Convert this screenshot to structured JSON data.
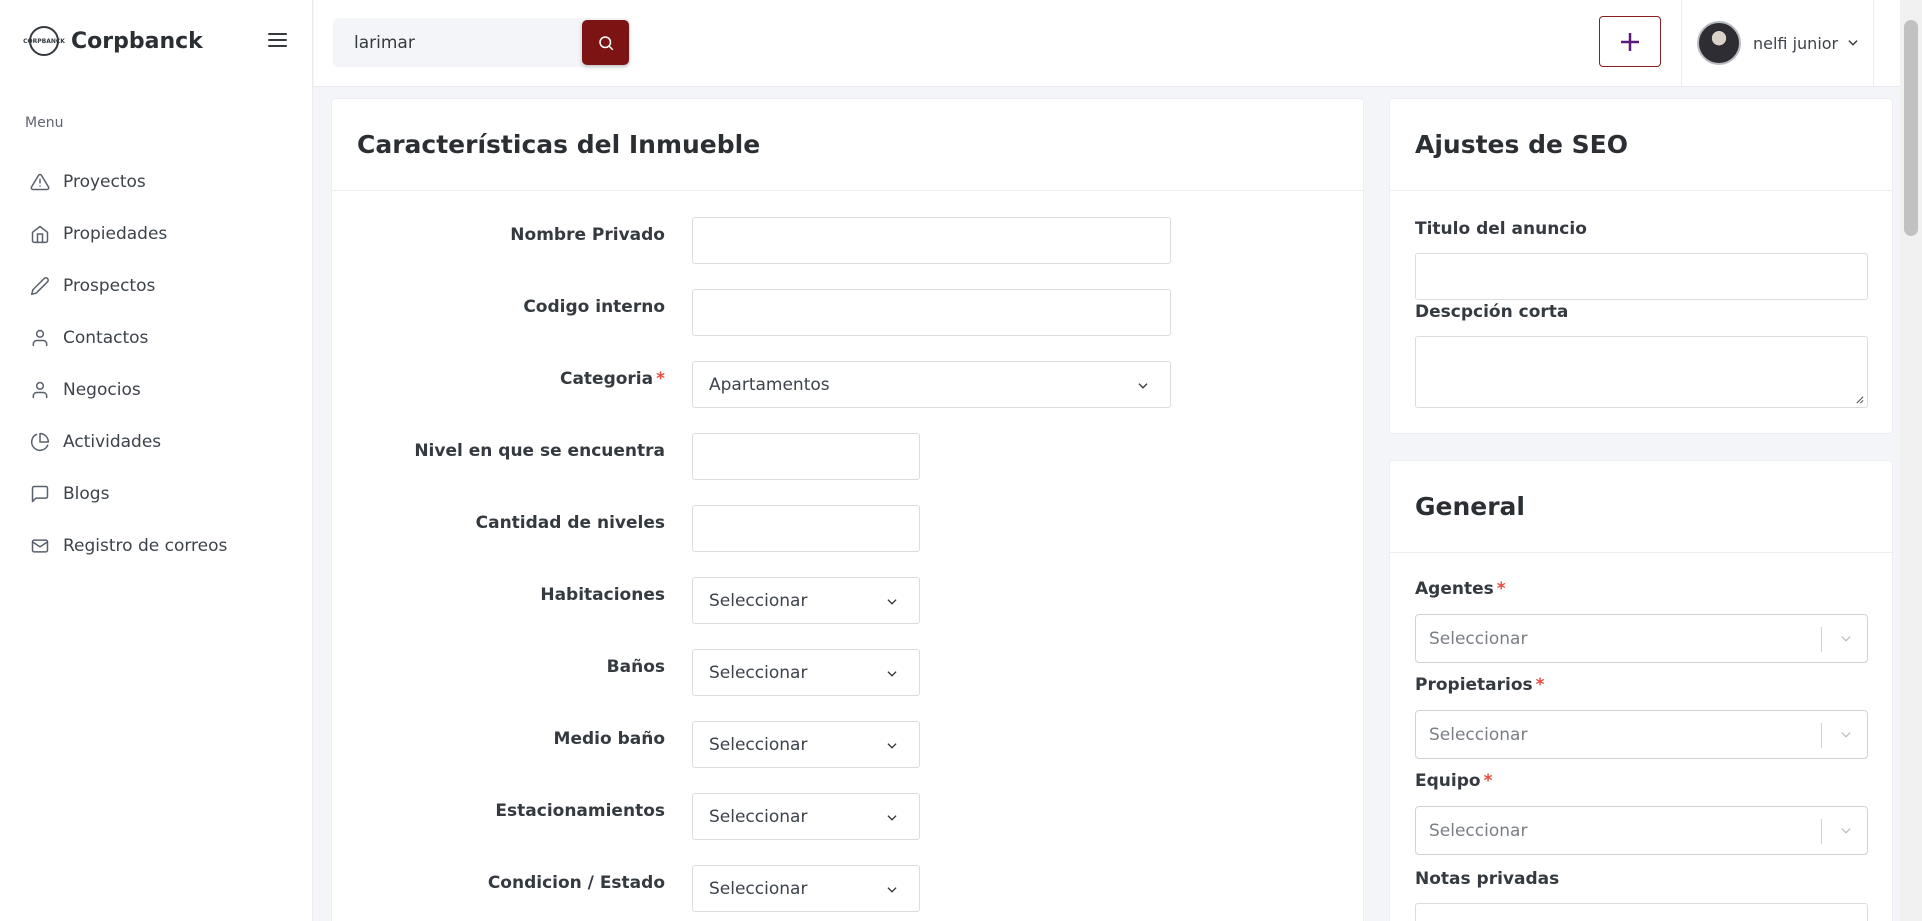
{
  "brand": {
    "name": "Corpbanck",
    "logo_text": "CORPBANCK"
  },
  "sidebar": {
    "menu_title": "Menu",
    "items": [
      {
        "label": "Proyectos",
        "icon": "warning-triangle-icon"
      },
      {
        "label": "Propiedades",
        "icon": "home-icon"
      },
      {
        "label": "Prospectos",
        "icon": "pencil-icon"
      },
      {
        "label": "Contactos",
        "icon": "user-icon"
      },
      {
        "label": "Negocios",
        "icon": "user-icon"
      },
      {
        "label": "Actividades",
        "icon": "pie-chart-icon"
      },
      {
        "label": "Blogs",
        "icon": "message-square-icon"
      },
      {
        "label": "Registro de correos",
        "icon": "mail-icon"
      }
    ]
  },
  "topbar": {
    "search_value": "larimar",
    "user_name": "nelfi junior"
  },
  "main": {
    "title": "Características del Inmueble",
    "fields": {
      "nombre_privado": {
        "label": "Nombre Privado",
        "value": ""
      },
      "codigo_interno": {
        "label": "Codigo interno",
        "value": ""
      },
      "categoria": {
        "label": "Categoria",
        "value": "Apartamentos",
        "required": "*"
      },
      "nivel": {
        "label": "Nivel en que se encuentra",
        "value": ""
      },
      "cantidad_niveles": {
        "label": "Cantidad de niveles",
        "value": ""
      },
      "habitaciones": {
        "label": "Habitaciones",
        "value": "Seleccionar"
      },
      "banos": {
        "label": "Baños",
        "value": "Seleccionar"
      },
      "medio_bano": {
        "label": "Medio baño",
        "value": "Seleccionar"
      },
      "estacionamientos": {
        "label": "Estacionamientos",
        "value": "Seleccionar"
      },
      "condicion": {
        "label": "Condicion / Estado",
        "value": "Seleccionar"
      }
    }
  },
  "seo": {
    "title": "Ajustes de SEO",
    "titulo_label": "Titulo del anuncio",
    "titulo_value": "",
    "descripcion_label": "Descpción corta",
    "descripcion_value": ""
  },
  "general": {
    "title": "General",
    "agentes_label": "Agentes",
    "propietarios_label": "Propietarios",
    "equipo_label": "Equipo",
    "required": "*",
    "placeholder": "Seleccionar",
    "notas_label": "Notas privadas"
  },
  "colors": {
    "accent": "#7c1414",
    "plus_icon": "#5a1b7a",
    "required": "#e74c3c"
  }
}
